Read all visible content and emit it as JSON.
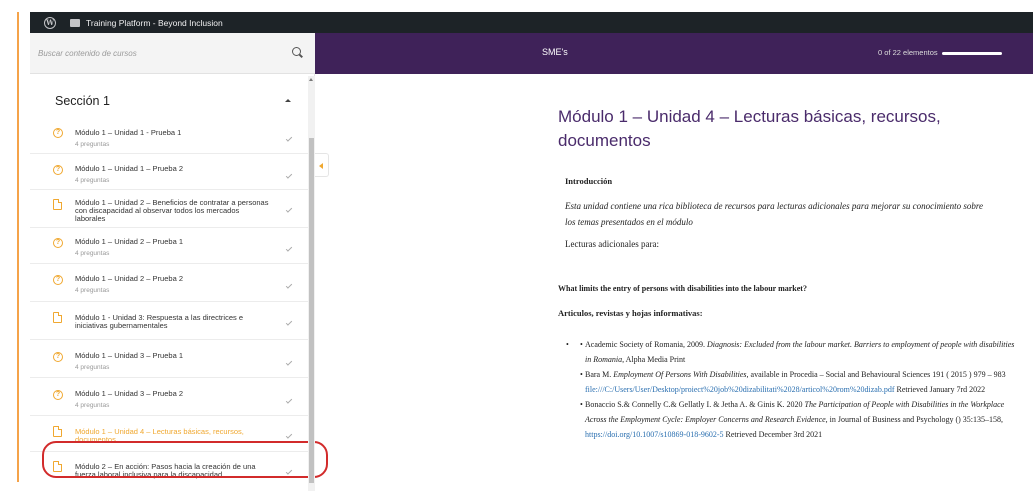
{
  "admin_bar": {
    "wp_logo": "W",
    "site_title": "Training Platform - Beyond Inclusion"
  },
  "search": {
    "placeholder": "Buscar contenido de cursos"
  },
  "section": {
    "title": "Sección 1"
  },
  "lessons": [
    {
      "type": "quiz",
      "title": "Módulo 1 – Unidad 1 - Prueba 1",
      "sub": "4 preguntas"
    },
    {
      "type": "quiz",
      "title": "Módulo 1 – Unidad 1 – Prueba 2",
      "sub": "4 preguntas"
    },
    {
      "type": "doc",
      "title": "Módulo 1 – Unidad 2 – Beneficios de contratar a personas con discapacidad al observar todos los mercados laborales",
      "sub": ""
    },
    {
      "type": "quiz",
      "title": "Módulo 1 – Unidad 2 – Prueba 1",
      "sub": "4 preguntas"
    },
    {
      "type": "quiz",
      "title": "Módulo 1 – Unidad 2 – Prueba 2",
      "sub": "4 preguntas"
    },
    {
      "type": "doc",
      "title": "Módulo 1 - Unidad 3: Respuesta a las directrices e iniciativas gubernamentales",
      "sub": ""
    },
    {
      "type": "quiz",
      "title": "Módulo 1 – Unidad 3 – Prueba 1",
      "sub": "4 preguntas"
    },
    {
      "type": "quiz",
      "title": "Módulo 1 – Unidad 3 – Prueba 2",
      "sub": "4 preguntas"
    },
    {
      "type": "doc",
      "title": "Módulo 1 – Unidad 4 – Lecturas básicas, recursos, documentos",
      "sub": "",
      "active": true
    },
    {
      "type": "doc",
      "title": "Módulo 2 – En acción: Pasos hacia la creación de una fuerza laboral inclusiva para la discapacidad",
      "sub": ""
    }
  ],
  "topbar": {
    "course_title": "SME's",
    "progress_text": "0 of 22 elementos",
    "progress_fraction": 0
  },
  "content": {
    "title": "Módulo 1 – Unidad 4 – Lecturas básicas, recursos, documentos",
    "intro_heading": "Introducción",
    "intro_text": "Esta unidad contiene una rica biblioteca de recursos para lecturas adicionales para mejorar su conocimiento sobre los temas presentados en el módulo",
    "additional": "Lecturas adicionales para:",
    "question": "What limits the entry of persons with disabilities into the labour market?",
    "articles_heading": "Articulos, revistas y hojas informativas:",
    "refs": {
      "r1": {
        "a": "Academic Society of Romania, 2009. ",
        "b": "Diagnosis: Excluded from the labour market. Barriers to employment of people with disabilities in Romania",
        "c": ", Alpha Media Print"
      },
      "r2": {
        "a": "Bara M. ",
        "b": "Employment Of Persons With Disabilities",
        "c": ", available in Procedia – Social and Behavioural Sciences 191 ( 2015 ) 979 – 983",
        "link": "file:///C:/Users/User/Desktop/proiect%20job%20dizabilitati%2028/articol%20rom%20dizab.pdf",
        "d": " Retrieved January 7rd 2022"
      },
      "r3": {
        "a": "Bonaccio S.& Connelly C.& Gellatly I. & Jetha A. & Ginis K. 2020 ",
        "b": "The Participation of People with Disabilities in the Workplace Across the Employment Cycle: Employer Concerns and Research Evidence",
        "c": ", in Journal of Business and Psychology () 35:135–158, ",
        "link": "https://doi.org/10.1007/s10869-018-9602-5",
        "d": " Retrieved December 3rd 2021"
      }
    }
  }
}
